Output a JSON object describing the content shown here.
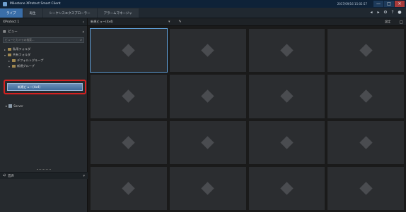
{
  "window": {
    "title": "Milestone XProtect Smart Client",
    "datetime": "2017/09/16 15:02:57",
    "minimize": "—",
    "maximize": "□",
    "close": "✕"
  },
  "tabs": [
    {
      "label": "ライブ",
      "active": true
    },
    {
      "label": "再生",
      "active": false
    },
    {
      "label": "シーケンスエクスプローラー",
      "active": false
    },
    {
      "label": "アラームマネージャ",
      "active": false
    }
  ],
  "tabbar_icons": [
    "back-icon",
    "forward-icon",
    "gear-icon",
    "help-icon",
    "lock-icon"
  ],
  "sidebar": {
    "product_title": "XProtect 1",
    "views_title": "ビュー",
    "search_placeholder": "ビューとカメラの検索...",
    "tree": [
      {
        "label": "私用フォルダ",
        "level": 0
      },
      {
        "label": "共有フォルダ",
        "level": 0
      },
      {
        "label": "デフォルトグループ",
        "level": 1
      },
      {
        "label": "新規グループ",
        "level": 1
      }
    ],
    "selected_view": "新規ビュー(4x4)",
    "server": "Server",
    "bottom_title": "音声"
  },
  "toolbar": {
    "view_name": "新規ビュー(4x4)",
    "setup": "設定"
  },
  "grid": {
    "rows": 4,
    "cols": 4,
    "selected_index": 0
  },
  "colors": {
    "accent": "#3a6ea8",
    "highlight": "#d62020",
    "selected_cell": "#5e9ed6"
  }
}
